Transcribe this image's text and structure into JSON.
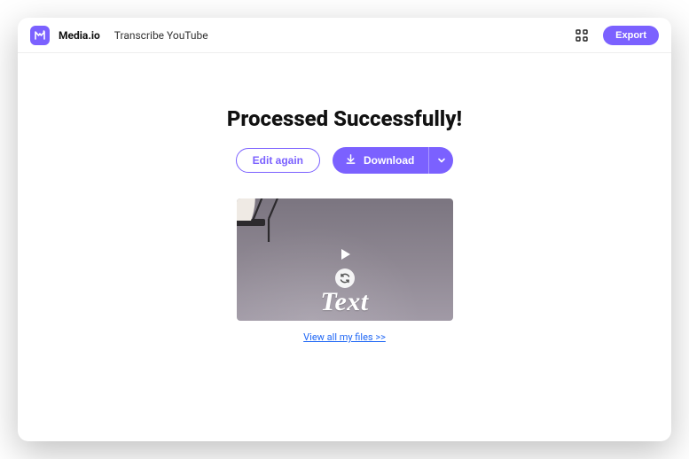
{
  "colors": {
    "accent": "#7B61FF",
    "link": "#1E66F5"
  },
  "header": {
    "brand": "Media.io",
    "page": "Transcribe YouTube",
    "export_label": "Export"
  },
  "main": {
    "heading": "Processed Successfully!",
    "edit_again_label": "Edit again",
    "download_label": "Download",
    "preview_text_overlay": "Text",
    "view_all_link": "View all my files >>"
  }
}
